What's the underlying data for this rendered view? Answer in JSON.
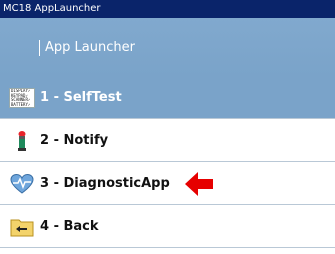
{
  "window": {
    "title": "MC18 AppLauncher"
  },
  "header": {
    "title": "App Launcher"
  },
  "menu": {
    "items": [
      {
        "label": "1 - SelfTest",
        "icon": "selftest-checklist-icon",
        "selected": true
      },
      {
        "label": "2 - Notify",
        "icon": "notify-light-icon",
        "selected": false
      },
      {
        "label": "3 - DiagnosticApp",
        "icon": "diagnostic-heart-icon",
        "selected": false
      },
      {
        "label": "4 - Back",
        "icon": "back-folder-icon",
        "selected": false
      }
    ]
  },
  "selftest_icon_text": [
    "DISPLAY",
    "KEYPAD",
    "SCANNER",
    "BATTERY"
  ],
  "colors": {
    "titlebar": "#0a246a",
    "header": "#7aa3c9",
    "selected_row": "#7aa3c9",
    "arrow": "#e60000"
  }
}
